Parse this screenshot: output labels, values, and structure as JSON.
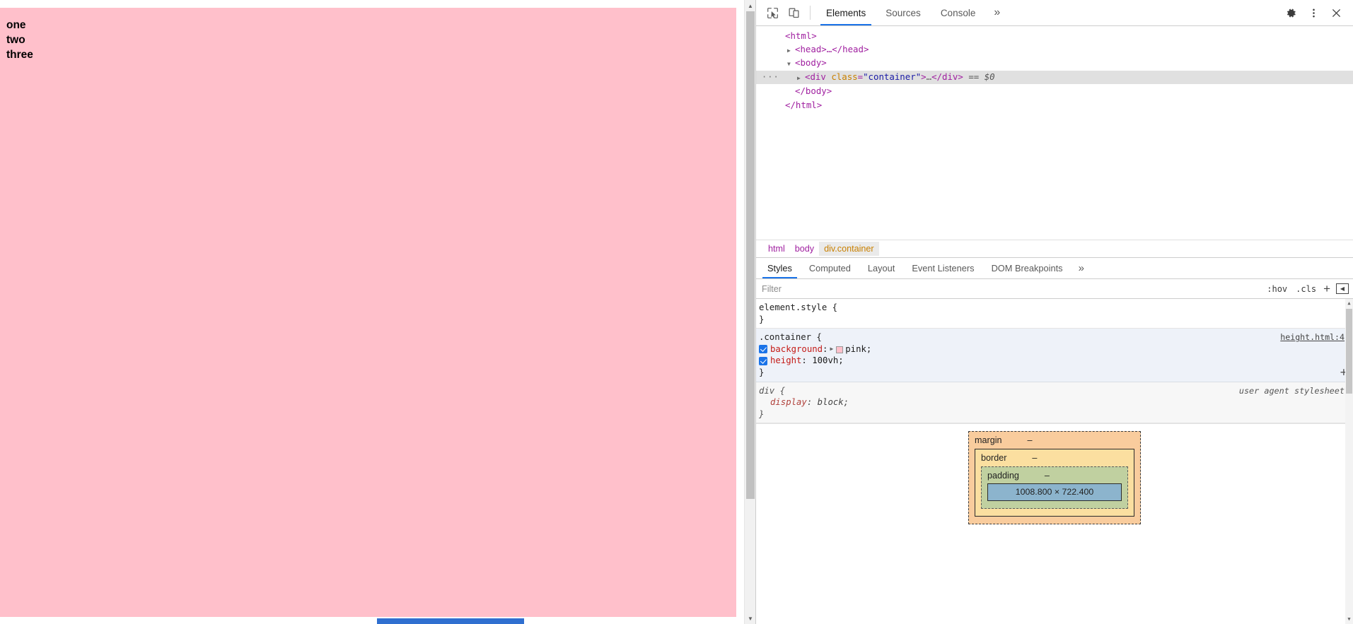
{
  "page": {
    "lines": [
      "one",
      "two",
      "three"
    ],
    "container_background": "#FFC0CB"
  },
  "devtools": {
    "toolbar": {
      "inspect_icon": "inspect-cursor-icon",
      "device_icon": "device-toolbar-icon",
      "settings_icon": "gear-icon",
      "more_icon": "kebab-menu-icon",
      "close_icon": "close-icon",
      "tabs": [
        {
          "label": "Elements",
          "active": true
        },
        {
          "label": "Sources",
          "active": false
        },
        {
          "label": "Console",
          "active": false
        }
      ],
      "more_tabs_label": "»"
    },
    "dom_tree": [
      {
        "indent": 0,
        "arrow": "",
        "text": "<html>",
        "selected": false
      },
      {
        "indent": 1,
        "arrow": "▶",
        "text": "<head>…</head>",
        "selected": false
      },
      {
        "indent": 1,
        "arrow": "▼",
        "text": "<body>",
        "selected": false
      },
      {
        "indent": 2,
        "arrow": "▶",
        "text": "<div class=\"container\">…</div> == $0",
        "selected": true,
        "gutter": "···"
      },
      {
        "indent": 1,
        "arrow": "",
        "text": "</body>",
        "selected": false
      },
      {
        "indent": 0,
        "arrow": "",
        "text": "</html>",
        "selected": false
      }
    ],
    "dom_row_parts": {
      "html_open": "<html>",
      "head_collapsed": "<head>…</head>",
      "body_open": "<body>",
      "div_tag_open": "<div ",
      "div_attr_name": "class",
      "div_eq": "=",
      "div_attr_value": "\"container\"",
      "div_tag_close": ">",
      "div_ellipsis": "…",
      "div_close_tag": "</div>",
      "div_selection_ref": "== $0",
      "body_close": "</body>",
      "html_close": "</html>"
    },
    "breadcrumbs": [
      {
        "label": "html",
        "active": false
      },
      {
        "label": "body",
        "active": false
      },
      {
        "label": "div.container",
        "active": true
      }
    ],
    "styles_tabs": [
      {
        "label": "Styles",
        "active": true
      },
      {
        "label": "Computed",
        "active": false
      },
      {
        "label": "Layout",
        "active": false
      },
      {
        "label": "Event Listeners",
        "active": false
      },
      {
        "label": "DOM Breakpoints",
        "active": false
      }
    ],
    "styles_more_label": "»",
    "filter": {
      "placeholder": "Filter",
      "value": "",
      "hov_label": ":hov",
      "cls_label": ".cls",
      "new_rule_label": "+",
      "sidebar_toggle_icon": "toggle-sidebar-icon"
    },
    "rules": {
      "element_style": {
        "selector": "element.style {",
        "close": "}"
      },
      "container_rule": {
        "selector": ".container {",
        "source": "height.html:4",
        "close": "}",
        "declarations": [
          {
            "enabled": true,
            "prop": "background",
            "colon": ":",
            "expander": "▶",
            "swatch": "#FFC0CB",
            "value": "pink;"
          },
          {
            "enabled": true,
            "prop": "height",
            "colon": ":",
            "value": "100vh;"
          }
        ],
        "add_button": "+"
      },
      "div_rule": {
        "selector": "div {",
        "origin": "user agent stylesheet",
        "close": "}",
        "declarations": [
          {
            "prop": "display",
            "colon": ":",
            "value": "block;"
          }
        ]
      }
    },
    "box_model": {
      "margin_label": "margin",
      "margin_value": "–",
      "border_label": "border",
      "border_value": "–",
      "padding_label": "padding",
      "padding_value": "–",
      "content_size": "1008.800 × 722.400"
    }
  }
}
